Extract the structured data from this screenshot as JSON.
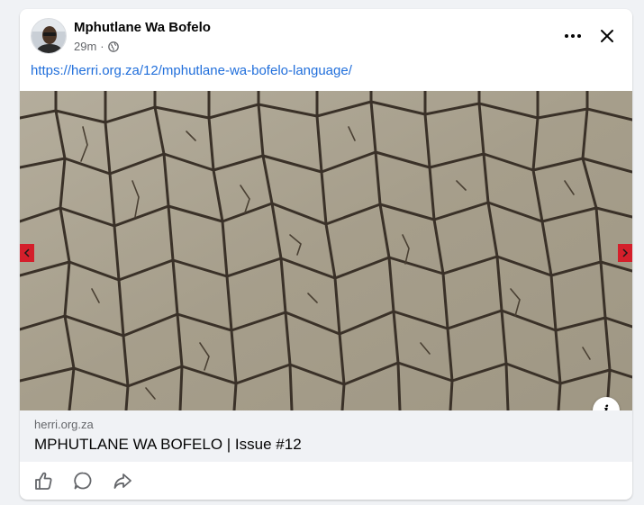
{
  "post": {
    "author": "Mphutlane Wa Bofelo",
    "time": "29m",
    "separator": "·",
    "audience_icon": "globe-icon",
    "link_text": "https://herri.org.za/12/mphutlane-wa-bofelo-language/"
  },
  "header": {
    "more_icon": "more-options-icon",
    "close_icon": "close-icon"
  },
  "image": {
    "description_icon": "info-icon",
    "info_label": "i"
  },
  "link_preview": {
    "domain": "herri.org.za",
    "title": "MPHUTLANE WA BOFELO | Issue #12"
  },
  "actions": {
    "items": [
      "like-icon",
      "comment-icon",
      "share-icon"
    ]
  },
  "colors": {
    "link": "#216fdb",
    "nav_arrow": "#d41f2b",
    "mud": "#a9a18f",
    "crack": "#3a3128"
  }
}
